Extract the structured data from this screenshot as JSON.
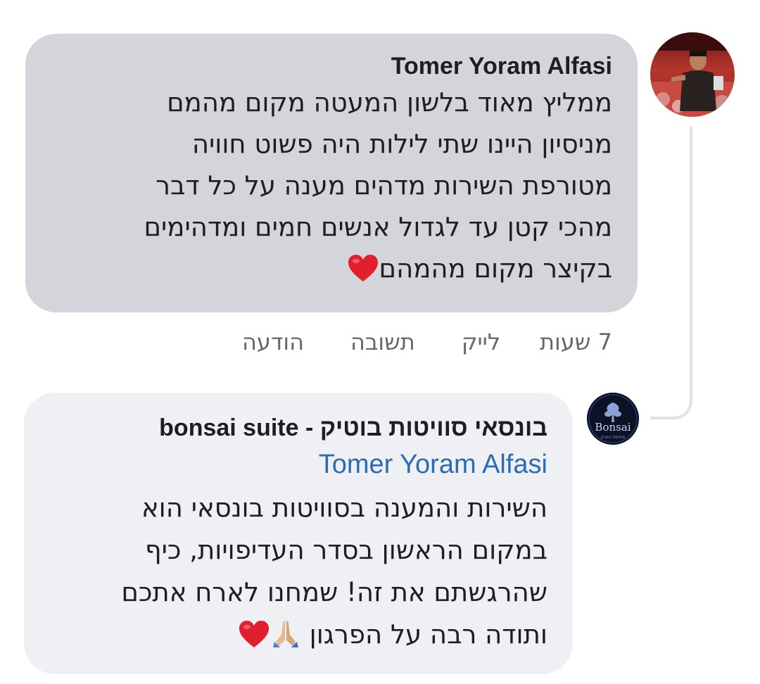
{
  "comment": {
    "author": "Tomer Yoram Alfasi",
    "lines": [
      "ממליץ מאוד בלשון המעטה מקום מהמם",
      "מניסיון היינו שתי לילות היה פשוט חוויה",
      "מטורפת השירות מדהים מענה על כל דבר",
      "מהכי קטן עד לגדול אנשים חמים ומדהימים",
      "בקיצר מקום מהמהם"
    ],
    "end_emoji": "red-heart-icon"
  },
  "actions": {
    "time": "7 שעות",
    "like": "לייק",
    "reply": "תשובה",
    "message": "הודעה"
  },
  "reply": {
    "author": "בונסאי סוויטות בוטיק - bonsai suite",
    "mention": "Tomer Yoram Alfasi",
    "lines": [
      "השירות והמענה בסוויטות בונסאי הוא",
      "במקום הראשון בסדר העדיפויות, כיף",
      "שהרגשתם את זה! שמחנו לארח אתכם",
      "ותודה רבה על הפרגון"
    ],
    "end_emojis": [
      "folded-hands-icon",
      "red-heart-icon"
    ],
    "avatar_text": "Bonsai",
    "avatar_subtext": "סוויטות בוטיק"
  },
  "colors": {
    "comment_bubble": "#d3d5da",
    "reply_bubble": "#eef0f3",
    "mention": "#2d6bb4",
    "action_text": "#65676b",
    "heart": "#e0202e"
  }
}
